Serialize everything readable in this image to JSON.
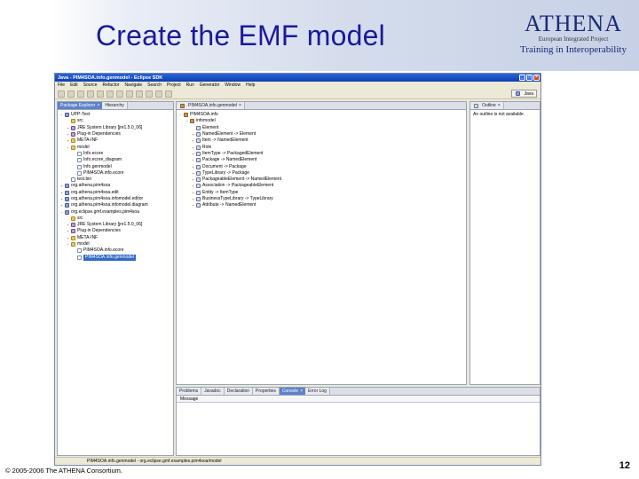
{
  "slide": {
    "title": "Create the EMF model",
    "logo_main": "ATHENA",
    "logo_sub": "European Integrated Project",
    "logo_tagline": "Training in Interoperability",
    "copyright": "© 2005-2006 The ATHENA Consortium.",
    "page_number": "12"
  },
  "eclipse": {
    "title": "Java - PIM4SOA.info.genmodel - Eclipse SDK",
    "menu": [
      "File",
      "Edit",
      "Source",
      "Refactor",
      "Navigate",
      "Search",
      "Project",
      "Run",
      "Generator",
      "Window",
      "Help"
    ],
    "perspective": "Java",
    "left_tabs": [
      "Package Explorer",
      "Hierarchy"
    ],
    "package_tree": [
      {
        "indent": 0,
        "toggle": "−",
        "icon": "proj",
        "label": "UPP-Test"
      },
      {
        "indent": 1,
        "toggle": "",
        "icon": "folder",
        "label": "src"
      },
      {
        "indent": 1,
        "toggle": "+",
        "icon": "lib",
        "label": "JRE System Library [jre1.5.0_06]"
      },
      {
        "indent": 1,
        "toggle": "+",
        "icon": "lib",
        "label": "Plug-in Dependencies"
      },
      {
        "indent": 1,
        "toggle": "+",
        "icon": "folder",
        "label": "META-INF"
      },
      {
        "indent": 1,
        "toggle": "−",
        "icon": "folder",
        "label": "model"
      },
      {
        "indent": 2,
        "toggle": "",
        "icon": "file",
        "label": "Info.ecore"
      },
      {
        "indent": 2,
        "toggle": "",
        "icon": "file",
        "label": "Info.ecore_diagram"
      },
      {
        "indent": 2,
        "toggle": "",
        "icon": "file",
        "label": "Info.genmodel"
      },
      {
        "indent": 2,
        "toggle": "",
        "icon": "file",
        "label": "PIM4SOA.info.ecore"
      },
      {
        "indent": 1,
        "toggle": "",
        "icon": "file",
        "label": "test.bin"
      },
      {
        "indent": 0,
        "toggle": "+",
        "icon": "proj",
        "label": "org.athena.pim4soa"
      },
      {
        "indent": 0,
        "toggle": "+",
        "icon": "proj",
        "label": "org.athena.pim4soa.edit"
      },
      {
        "indent": 0,
        "toggle": "+",
        "icon": "proj",
        "label": "org.athena.pim4soa.infomodel.editor"
      },
      {
        "indent": 0,
        "toggle": "+",
        "icon": "proj",
        "label": "org.athena.pim4soa.infomodel.diagram"
      },
      {
        "indent": 0,
        "toggle": "−",
        "icon": "proj",
        "label": "org.eclipse.gmf.examples.pim4soa"
      },
      {
        "indent": 1,
        "toggle": "",
        "icon": "folder",
        "label": "src"
      },
      {
        "indent": 1,
        "toggle": "+",
        "icon": "lib",
        "label": "JRE System Library [jre1.5.0_06]"
      },
      {
        "indent": 1,
        "toggle": "+",
        "icon": "lib",
        "label": "Plug-in Dependencies"
      },
      {
        "indent": 1,
        "toggle": "+",
        "icon": "folder",
        "label": "META-INF"
      },
      {
        "indent": 1,
        "toggle": "−",
        "icon": "folder",
        "label": "model"
      },
      {
        "indent": 2,
        "toggle": "",
        "icon": "file",
        "label": "PIM4SOA.info.ecore"
      },
      {
        "indent": 2,
        "toggle": "",
        "icon": "file",
        "label": "PIM4SOA.info.genmodel",
        "selected": true
      }
    ],
    "editor_tab": "PIM4SOA.info.genmodel",
    "editor_tree": [
      {
        "indent": 0,
        "toggle": "−",
        "icon": "pkg",
        "label": "PIM4SOA.info"
      },
      {
        "indent": 1,
        "toggle": "−",
        "icon": "pkg",
        "label": "infomodel"
      },
      {
        "indent": 2,
        "toggle": "",
        "icon": "cls",
        "label": "Element"
      },
      {
        "indent": 2,
        "toggle": "+",
        "icon": "cls",
        "label": "NamedElement -> Element"
      },
      {
        "indent": 2,
        "toggle": "+",
        "icon": "cls",
        "label": "Item -> NamedElement"
      },
      {
        "indent": 2,
        "toggle": "+",
        "icon": "cls",
        "label": "Role"
      },
      {
        "indent": 2,
        "toggle": "+",
        "icon": "cls",
        "label": "ItemType -> PackagedElement"
      },
      {
        "indent": 2,
        "toggle": "+",
        "icon": "cls",
        "label": "Package -> NamedElement"
      },
      {
        "indent": 2,
        "toggle": "+",
        "icon": "cls",
        "label": "Document -> Package"
      },
      {
        "indent": 2,
        "toggle": "+",
        "icon": "cls",
        "label": "TypeLibrary -> Package"
      },
      {
        "indent": 2,
        "toggle": "+",
        "icon": "cls",
        "label": "PackageableElement -> NamedElement"
      },
      {
        "indent": 2,
        "toggle": "+",
        "icon": "cls",
        "label": "Association -> PackageableElement"
      },
      {
        "indent": 2,
        "toggle": "+",
        "icon": "cls",
        "label": "Entity -> ItemType"
      },
      {
        "indent": 2,
        "toggle": "+",
        "icon": "cls",
        "label": "BusinessTypeLibrary -> TypeLibrary"
      },
      {
        "indent": 2,
        "toggle": "+",
        "icon": "cls",
        "label": "Attribute -> NamedElement"
      }
    ],
    "outline_tab": "Outline",
    "outline_message": "An outline is not available.",
    "bottom_tabs": [
      "Problems",
      "Javadoc",
      "Declaration",
      "Properties",
      "Console",
      "Error Log"
    ],
    "bottom_active": "Console",
    "console_header": "Message",
    "status_text": "PIM4SOA.info.genmodel - org.eclipse.gmf.examples.pim4soa/model"
  }
}
